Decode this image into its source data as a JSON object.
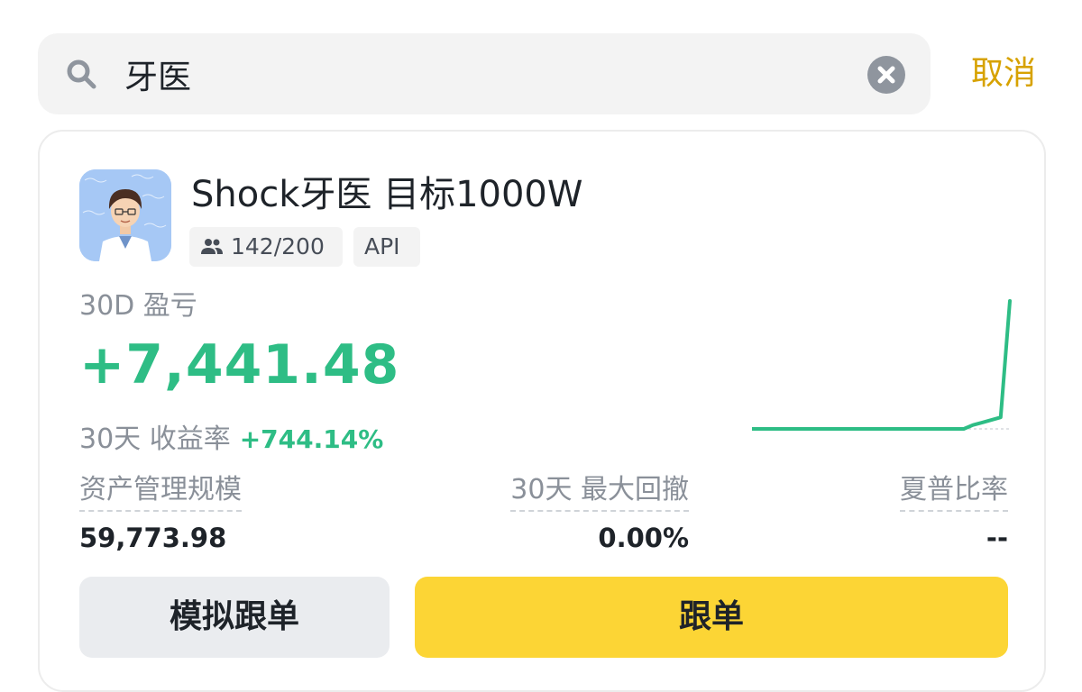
{
  "search": {
    "query": "牙医",
    "cancel_label": "取消"
  },
  "trader": {
    "name": "Shock牙医 目标1000W",
    "followers": "142/200",
    "api_tag": "API",
    "avatar_text": "Shock Dentist"
  },
  "pnl": {
    "label": "30D 盈亏",
    "value": "+7,441.48",
    "roi_label": "30天 收益率",
    "roi_value": "+744.14%"
  },
  "metrics": {
    "aum_label": "资产管理规模",
    "aum_value": "59,773.98",
    "mdd_label": "30天 最大回撤",
    "mdd_value": "0.00%",
    "sharpe_label": "夏普比率",
    "sharpe_value": "--"
  },
  "buttons": {
    "mock_copy": "模拟跟单",
    "copy": "跟单"
  },
  "colors": {
    "positive": "#2ebd85",
    "primary_button": "#fcd535",
    "cancel_text": "#d7a200"
  },
  "sparkline": {
    "points": [
      0,
      0,
      0,
      0,
      0,
      0,
      0,
      0,
      0,
      0,
      0,
      0,
      0,
      0,
      0,
      0,
      0,
      0,
      0,
      0,
      0,
      0,
      0,
      0,
      0.03,
      0.05,
      0.07,
      0.09,
      1.0
    ]
  }
}
